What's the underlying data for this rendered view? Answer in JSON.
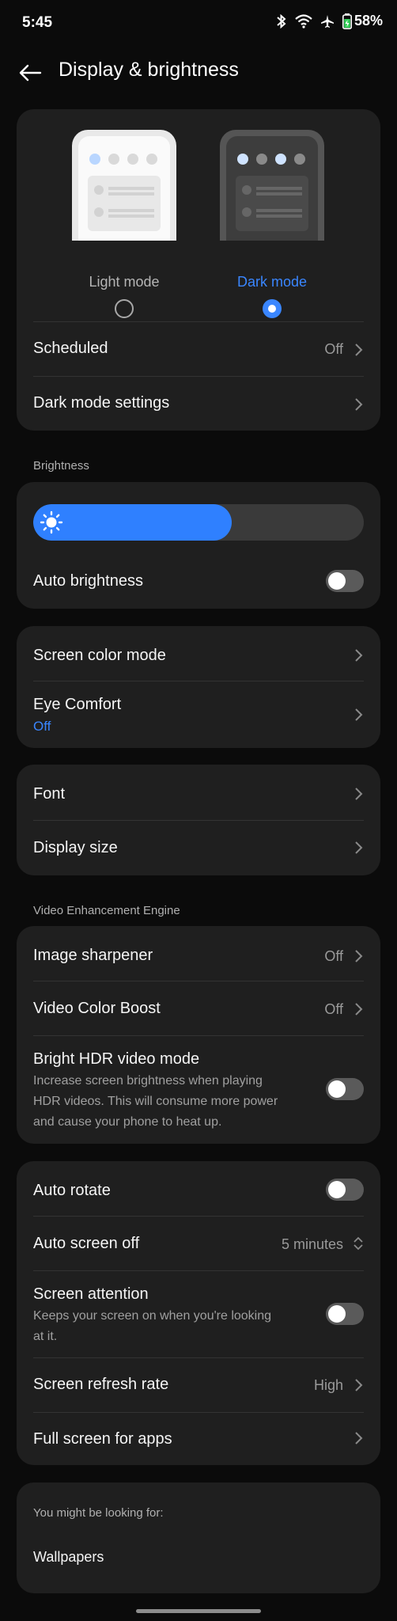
{
  "status_bar": {
    "time": "5:45",
    "battery": "58%"
  },
  "header": {
    "title": "Display & brightness"
  },
  "theme": {
    "light_label": "Light mode",
    "dark_label": "Dark mode",
    "selected": "dark",
    "accent": "#3a86ff"
  },
  "theme_card": {
    "scheduled_label": "Scheduled",
    "scheduled_value": "Off",
    "dark_settings_label": "Dark mode settings"
  },
  "brightness": {
    "section_label": "Brightness",
    "level": 0.6,
    "auto_label": "Auto brightness",
    "auto_on": false
  },
  "color_card": {
    "screen_color_label": "Screen color mode",
    "eye_comfort_label": "Eye Comfort",
    "eye_comfort_value": "Off"
  },
  "font_card": {
    "font_label": "Font",
    "display_size_label": "Display size"
  },
  "video": {
    "section_label": "Video Enhancement Engine",
    "sharpener_label": "Image sharpener",
    "sharpener_value": "Off",
    "color_boost_label": "Video Color Boost",
    "color_boost_value": "Off",
    "hdr_label": "Bright HDR video mode",
    "hdr_desc_1": "Increase screen brightness when playing",
    "hdr_desc_2": "HDR videos. This will consume more power",
    "hdr_desc_3": "and cause your phone to heat up."
  },
  "screen_card": {
    "auto_rotate_label": "Auto rotate",
    "auto_off_label": "Auto screen off",
    "auto_off_value": "5 minutes",
    "attention_label": "Screen attention",
    "attention_desc_1": "Keeps your screen on when you're looking",
    "attention_desc_2": "at it.",
    "refresh_label": "Screen refresh rate",
    "refresh_value": "High",
    "fullscreen_label": "Full screen for apps"
  },
  "suggest": {
    "heading": "You might be looking for:",
    "item": "Wallpapers"
  }
}
